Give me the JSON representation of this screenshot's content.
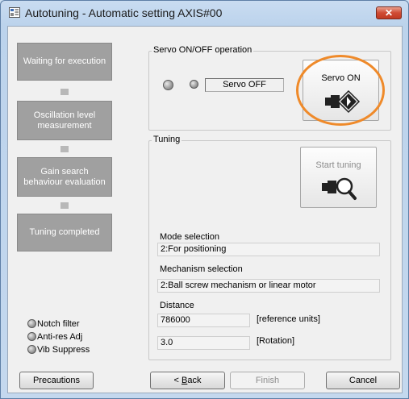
{
  "window": {
    "title": "Autotuning - Automatic setting AXIS#00",
    "close_label": "✕"
  },
  "steps": [
    {
      "label": "Waiting for execution"
    },
    {
      "label": "Oscillation level measurement"
    },
    {
      "label": "Gain search behaviour evaluation"
    },
    {
      "label": "Tuning completed"
    }
  ],
  "servo_group": {
    "title": "Servo ON/OFF operation",
    "status": "Servo OFF",
    "button_label": "Servo ON",
    "button_icon": "servo-on-icon"
  },
  "tuning_group": {
    "title": "Tuning",
    "button_label": "Start tuning",
    "button_icon": "magnifier-icon",
    "mode_label": "Mode selection",
    "mode_value": "2:For positioning",
    "mechanism_label": "Mechanism selection",
    "mechanism_value": "2:Ball screw mechanism or linear motor",
    "distance_label": "Distance",
    "distance_value": "786000",
    "distance_unit": "[reference units]",
    "rotation_value": "3.0",
    "rotation_unit": "[Rotation]"
  },
  "indicators": [
    {
      "label": "Notch filter"
    },
    {
      "label": "Anti-res Adj"
    },
    {
      "label": "Vib Suppress"
    }
  ],
  "buttons": {
    "precautions": "Precautions",
    "back_prefix": "< ",
    "back_accel": "B",
    "back_rest": "ack",
    "finish": "Finish",
    "cancel": "Cancel"
  },
  "colors": {
    "highlight": "#ef8a2a",
    "step_active": "#a0a0a0",
    "close_button": "#cf4b33"
  }
}
